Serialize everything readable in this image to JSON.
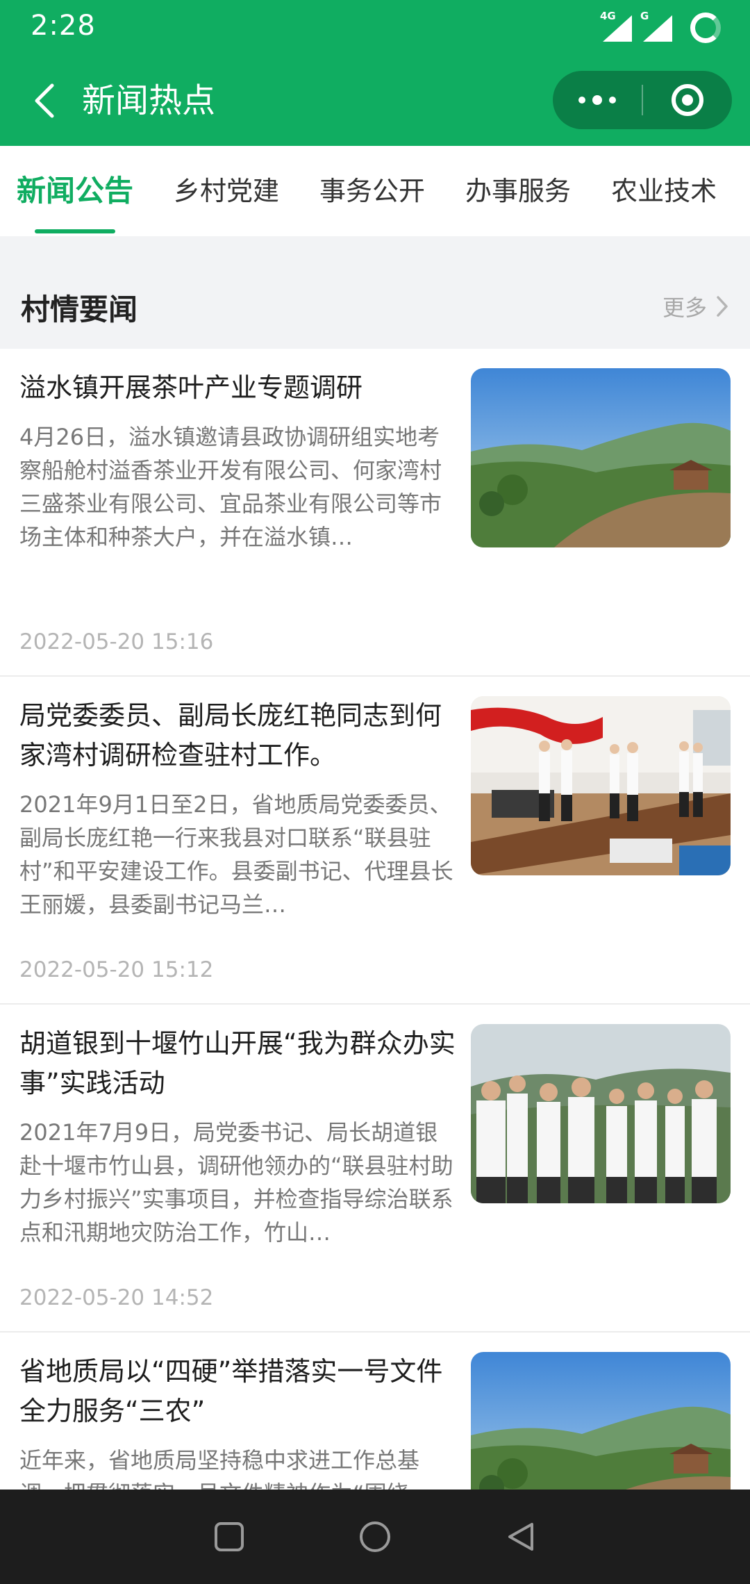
{
  "status": {
    "time": "2:28",
    "network_label_1": "4G",
    "network_label_2": "G"
  },
  "header": {
    "title": "新闻热点",
    "back_icon": "chevron-left-icon",
    "more_icon": "more-dots-icon",
    "close_icon": "target-circle-icon",
    "accent_color": "#10ad61"
  },
  "tabs": [
    {
      "label": "新闻公告",
      "active": true
    },
    {
      "label": "乡村党建",
      "active": false
    },
    {
      "label": "事务公开",
      "active": false
    },
    {
      "label": "办事服务",
      "active": false
    },
    {
      "label": "农业技术",
      "active": false
    }
  ],
  "section": {
    "title": "村情要闻",
    "more_label": "更多"
  },
  "news": [
    {
      "title": "溢水镇开展茶叶产业专题调研",
      "summary": "4月26日，溢水镇邀请县政协调研组实地考察船舱村溢香茶业开发有限公司、何家湾村三盛茶业有限公司、宜品茶业有限公司等市场主体和种茶大户，并在溢水镇…",
      "date": "2022-05-20 15:16",
      "image": "landscape-photo"
    },
    {
      "title": "局党委委员、副局长庞红艳同志到何家湾村调研检查驻村工作。",
      "summary": "2021年9月1日至2日，省地质局党委委员、副局长庞红艳一行来我县对口联系“联县驻村”和平安建设工作。县委副书记、代理县长王丽媛，县委副书记马兰…",
      "date": "2022-05-20 15:12",
      "image": "meeting-room-photo"
    },
    {
      "title": "胡道银到十堰竹山开展“我为群众办实事”实践活动",
      "summary": "2021年7月9日，局党委书记、局长胡道银赴十堰市竹山县，调研他领办的“联县驻村助力乡村振兴”实事项目，并检查指导综治联系点和汛期地灾防治工作，竹山…",
      "date": "2022-05-20 14:52",
      "image": "group-outdoor-photo"
    },
    {
      "title": "省地质局以“四硬”举措落实一号文件全力服务“三农”",
      "summary": "近年来，省地质局坚持稳中求进工作总基调，把贯彻落实一号文件精神作为“围绕",
      "date": "",
      "image": "landscape-photo"
    }
  ],
  "navbar": {
    "items": [
      "recent-apps-icon",
      "home-icon",
      "back-triangle-icon"
    ]
  }
}
